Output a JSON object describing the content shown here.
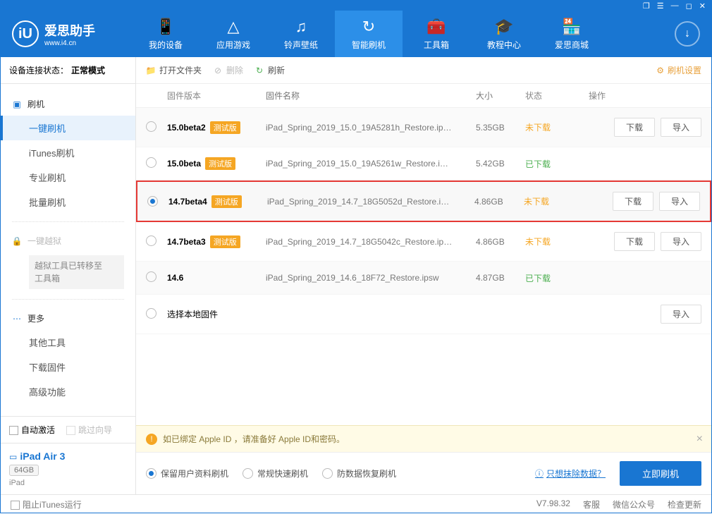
{
  "app": {
    "name": "爱思助手",
    "url": "www.i4.cn"
  },
  "titlebar": {
    "t1": "❐",
    "t2": "☰",
    "t3": "—",
    "t4": "◻",
    "t5": "✕"
  },
  "nav": [
    {
      "icon": "📱",
      "label": "我的设备"
    },
    {
      "icon": "△",
      "label": "应用游戏"
    },
    {
      "icon": "♫",
      "label": "铃声壁纸"
    },
    {
      "icon": "↻",
      "label": "智能刷机"
    },
    {
      "icon": "🧰",
      "label": "工具箱"
    },
    {
      "icon": "🎓",
      "label": "教程中心"
    },
    {
      "icon": "🏪",
      "label": "爱思商城"
    }
  ],
  "sidebar": {
    "conn_label": "设备连接状态：",
    "conn_status": "正常模式",
    "g1": "刷机",
    "g1_items": [
      "一键刷机",
      "iTunes刷机",
      "专业刷机",
      "批量刷机"
    ],
    "g2": "一键越狱",
    "g2_note": "越狱工具已转移至\n工具箱",
    "g3": "更多",
    "g3_items": [
      "其他工具",
      "下载固件",
      "高级功能"
    ]
  },
  "checks": {
    "auto_activate": "自动激活",
    "skip_guide": "跳过向导"
  },
  "device": {
    "name": "iPad Air 3",
    "storage": "64GB",
    "type": "iPad"
  },
  "toolbar": {
    "open": "打开文件夹",
    "delete": "删除",
    "refresh": "刷新",
    "settings": "刷机设置"
  },
  "columns": {
    "version": "固件版本",
    "name": "固件名称",
    "size": "大小",
    "status": "状态",
    "ops": "操作"
  },
  "beta_tag": "测试版",
  "status": {
    "no": "未下载",
    "yes": "已下载"
  },
  "buttons": {
    "download": "下载",
    "import": "导入"
  },
  "rows": [
    {
      "ver": "15.0beta2",
      "beta": true,
      "name": "iPad_Spring_2019_15.0_19A5281h_Restore.ip…",
      "size": "5.35GB",
      "status": "no",
      "ops": [
        "download",
        "import"
      ],
      "selected": false,
      "highlight": false
    },
    {
      "ver": "15.0beta",
      "beta": true,
      "name": "iPad_Spring_2019_15.0_19A5261w_Restore.i…",
      "size": "5.42GB",
      "status": "yes",
      "ops": [],
      "selected": false,
      "highlight": false
    },
    {
      "ver": "14.7beta4",
      "beta": true,
      "name": "iPad_Spring_2019_14.7_18G5052d_Restore.i…",
      "size": "4.86GB",
      "status": "no",
      "ops": [
        "download",
        "import"
      ],
      "selected": true,
      "highlight": true
    },
    {
      "ver": "14.7beta3",
      "beta": true,
      "name": "iPad_Spring_2019_14.7_18G5042c_Restore.ip…",
      "size": "4.86GB",
      "status": "no",
      "ops": [
        "download",
        "import"
      ],
      "selected": false,
      "highlight": false
    },
    {
      "ver": "14.6",
      "beta": false,
      "name": "iPad_Spring_2019_14.6_18F72_Restore.ipsw",
      "size": "4.87GB",
      "status": "yes",
      "ops": [],
      "selected": false,
      "highlight": false
    }
  ],
  "local_row": "选择本地固件",
  "warning": "如已绑定 Apple ID ，请准备好 Apple ID和密码。",
  "flash_opts": [
    "保留用户资料刷机",
    "常规快速刷机",
    "防数据恢复刷机"
  ],
  "flash_link": "只想抹除数据？",
  "flash_btn": "立即刷机",
  "statusbar": {
    "block_itunes": "阻止iTunes运行",
    "version": "V7.98.32",
    "kefu": "客服",
    "wechat": "微信公众号",
    "update": "检查更新"
  }
}
